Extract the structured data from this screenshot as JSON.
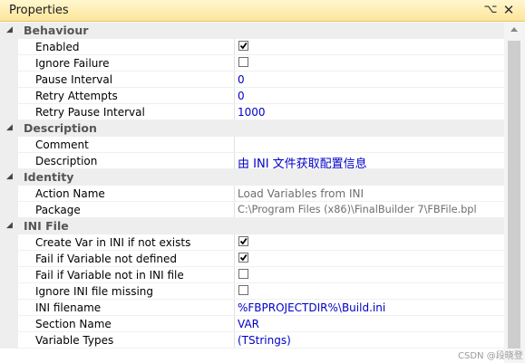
{
  "panel": {
    "title": "Properties",
    "pin_glyph": "⌥",
    "close_glyph": "✕"
  },
  "categories": {
    "behaviour": "Behaviour",
    "description": "Description",
    "identity": "Identity",
    "ini_file": "INI File"
  },
  "props": {
    "enabled": {
      "name": "Enabled",
      "checked": true
    },
    "ignore_failure": {
      "name": "Ignore Failure",
      "checked": false
    },
    "pause_interval": {
      "name": "Pause Interval",
      "value": "0"
    },
    "retry_attempts": {
      "name": "Retry Attempts",
      "value": "0"
    },
    "retry_pause_interval": {
      "name": "Retry Pause Interval",
      "value": "1000"
    },
    "comment": {
      "name": "Comment",
      "value": ""
    },
    "description": {
      "name": "Description",
      "value": "由 INI 文件获取配置信息"
    },
    "action_name": {
      "name": "Action Name",
      "value": "Load Variables from INI"
    },
    "package": {
      "name": "Package",
      "value": "C:\\Program Files (x86)\\FinalBuilder 7\\FBFile.bpl"
    },
    "create_var": {
      "name": "Create Var in INI if not exists",
      "checked": true
    },
    "fail_not_defined": {
      "name": "Fail if Variable not defined",
      "checked": true
    },
    "fail_not_in_ini": {
      "name": "Fail if Variable not in INI file",
      "checked": false
    },
    "ignore_missing": {
      "name": "Ignore INI file missing",
      "checked": false
    },
    "ini_filename": {
      "name": "INI filename",
      "value": "%FBPROJECTDIR%\\Build.ini"
    },
    "section_name": {
      "name": "Section Name",
      "value": "VAR"
    },
    "variable_types": {
      "name": "Variable Types",
      "value": "(TStrings)"
    }
  },
  "watermark": "CSDN @段晓登"
}
